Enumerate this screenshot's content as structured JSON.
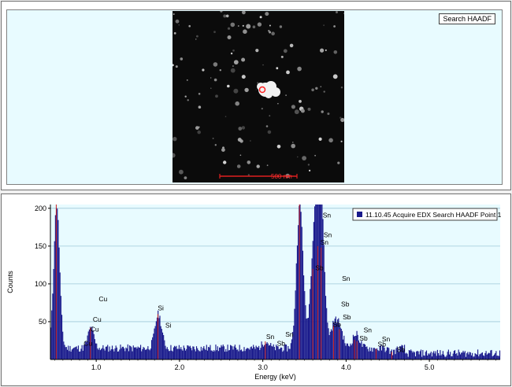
{
  "image_panel": {
    "search_label": "Search HAADF",
    "scale_bar_label": "500 nm",
    "colors": {
      "background": "#e8fbff",
      "image": "#0b0b0b",
      "marker": "#ff2020"
    }
  },
  "chart_data": {
    "type": "bar",
    "title": "",
    "legend": "11.10.45 Acquire EDX Search HAADF Point 1",
    "legend_position": "top-right",
    "xlabel": "Energy (keV)",
    "ylabel": "Counts",
    "xlim": [
      0.45,
      5.85
    ],
    "ylim": [
      0,
      205
    ],
    "x_ticks": [
      {
        "v": 1.0,
        "label": "1.0"
      },
      {
        "v": 2.0,
        "label": "2.0"
      },
      {
        "v": 3.0,
        "label": "3.0"
      },
      {
        "v": 4.0,
        "label": "4.0"
      },
      {
        "v": 5.0,
        "label": "5.0"
      }
    ],
    "y_ticks": [
      {
        "v": 50,
        "label": "50"
      },
      {
        "v": 100,
        "label": "100"
      },
      {
        "v": 150,
        "label": "150"
      },
      {
        "v": 200,
        "label": "200"
      }
    ],
    "grid": true,
    "colors": {
      "bars": "#1a1a8c",
      "peak_lines": "#cc2222",
      "plot_bg": "#e8fbff"
    },
    "background_level": 15,
    "peaks": [
      {
        "x": 0.52,
        "height": 205
      },
      {
        "x": 0.93,
        "height": 42
      },
      {
        "x": 1.74,
        "height": 60
      },
      {
        "x": 3.03,
        "height": 24
      },
      {
        "x": 3.44,
        "height": 205
      },
      {
        "x": 3.6,
        "height": 120
      },
      {
        "x": 3.66,
        "height": 150
      },
      {
        "x": 3.7,
        "height": 148
      },
      {
        "x": 3.85,
        "height": 45
      },
      {
        "x": 3.92,
        "height": 40
      },
      {
        "x": 4.1,
        "height": 26
      },
      {
        "x": 4.13,
        "height": 24
      },
      {
        "x": 4.36,
        "height": 14
      },
      {
        "x": 4.55,
        "height": 10
      }
    ],
    "peak_labels": [
      {
        "text": "Cu",
        "x": 0.85,
        "y": 18
      },
      {
        "text": "Cu",
        "x": 0.96,
        "y": 50
      },
      {
        "text": "Cu",
        "x": 0.93,
        "y": 37
      },
      {
        "text": "Cu",
        "x": 1.03,
        "y": 77
      },
      {
        "text": "Si",
        "x": 1.74,
        "y": 65
      },
      {
        "text": "Si",
        "x": 1.83,
        "y": 42
      },
      {
        "text": "Sn",
        "x": 3.04,
        "y": 27
      },
      {
        "text": "Sb",
        "x": 3.17,
        "y": 18
      },
      {
        "text": "Sn",
        "x": 3.27,
        "y": 30
      },
      {
        "text": "Sn",
        "x": 3.72,
        "y": 188
      },
      {
        "text": "Sn",
        "x": 3.73,
        "y": 162
      },
      {
        "text": "Sn",
        "x": 3.69,
        "y": 152
      },
      {
        "text": "Sb",
        "x": 3.63,
        "y": 118
      },
      {
        "text": "Sn",
        "x": 3.95,
        "y": 104
      },
      {
        "text": "Sb",
        "x": 3.94,
        "y": 70
      },
      {
        "text": "Sb",
        "x": 3.96,
        "y": 53
      },
      {
        "text": "Sb",
        "x": 3.84,
        "y": 43
      },
      {
        "text": "Sn",
        "x": 4.21,
        "y": 36
      },
      {
        "text": "Sb",
        "x": 4.16,
        "y": 25
      },
      {
        "text": "Sn",
        "x": 4.43,
        "y": 24
      },
      {
        "text": "Sb",
        "x": 4.38,
        "y": 17
      },
      {
        "text": "Sb",
        "x": 4.61,
        "y": 10
      }
    ]
  }
}
